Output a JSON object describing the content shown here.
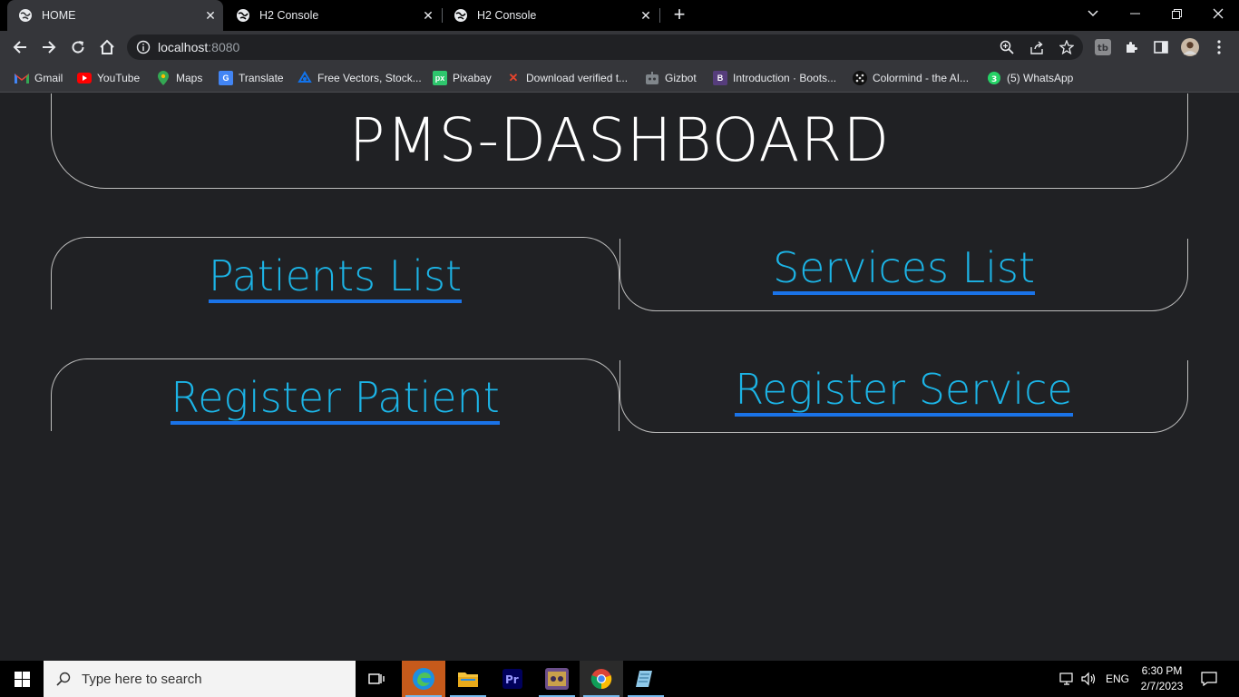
{
  "tabs": [
    {
      "title": "HOME",
      "active": true
    },
    {
      "title": "H2 Console",
      "active": false
    },
    {
      "title": "H2 Console",
      "active": false
    }
  ],
  "address": {
    "host": "localhost",
    "port": ":8080"
  },
  "bookmarks": [
    {
      "label": "Gmail",
      "icon": "gmail-icon",
      "color": "#ea4335"
    },
    {
      "label": "YouTube",
      "icon": "youtube-icon",
      "color": "#ff0000"
    },
    {
      "label": "Maps",
      "icon": "maps-icon",
      "color": "#34a853"
    },
    {
      "label": "Translate",
      "icon": "translate-icon",
      "color": "#4285f4"
    },
    {
      "label": "Free Vectors, Stock...",
      "icon": "freepik-icon",
      "color": "#1273eb"
    },
    {
      "label": "Pixabay",
      "icon": "pixabay-icon",
      "color": "#2ec66d"
    },
    {
      "label": "Download verified t...",
      "icon": "x-icon",
      "color": "#e8442c"
    },
    {
      "label": "Gizbot",
      "icon": "gizbot-icon",
      "color": "#5f6368"
    },
    {
      "label": "Introduction · Boots...",
      "icon": "bootstrap-icon",
      "color": "#563d7c"
    },
    {
      "label": "Colormind - the AI...",
      "icon": "colormind-icon",
      "color": "#222222"
    },
    {
      "label": "(5) WhatsApp",
      "icon": "whatsapp-icon",
      "color": "#25d366"
    }
  ],
  "page": {
    "title": "PMS-DASHBOARD",
    "links": {
      "patients_list": "Patients List",
      "services_list": "Services List",
      "register_patient": "Register Patient",
      "register_service": "Register Service"
    }
  },
  "taskbar": {
    "search_placeholder": "Type here to search",
    "language": "ENG",
    "time": "6:30 PM",
    "date": "2/7/2023"
  },
  "colors": {
    "link": "#1cb4e6",
    "underline": "#1a73e8",
    "background": "#202124"
  }
}
